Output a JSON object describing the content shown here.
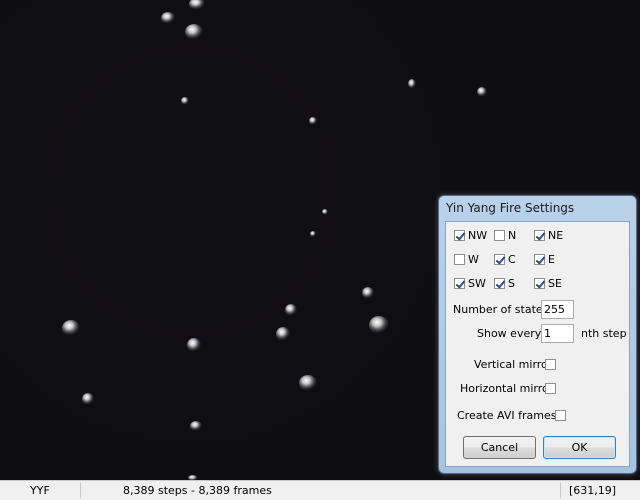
{
  "statusbar": {
    "rule": "YYF",
    "progress": "8,389 steps - 8,389 frames",
    "coords": "[631,19]"
  },
  "dialog": {
    "title": "Yin Yang Fire Settings",
    "neighbors": {
      "nw": {
        "label": "NW",
        "checked": true
      },
      "n": {
        "label": "N",
        "checked": false
      },
      "ne": {
        "label": "NE",
        "checked": true
      },
      "w": {
        "label": "W",
        "checked": false
      },
      "c": {
        "label": "C",
        "checked": true
      },
      "e": {
        "label": "E",
        "checked": true
      },
      "sw": {
        "label": "SW",
        "checked": true
      },
      "s": {
        "label": "S",
        "checked": true
      },
      "se": {
        "label": "SE",
        "checked": true
      }
    },
    "states_label": "Number of states",
    "states_value": "255",
    "show_every_label": "Show every",
    "show_every_value": "1",
    "nth_step_label": "nth step",
    "vertical_mirror_label": "Vertical mirror",
    "vertical_mirror_checked": false,
    "horizontal_mirror_label": "Horizontal mirror",
    "horizontal_mirror_checked": false,
    "avi_label": "Create AVI frames",
    "avi_checked": false,
    "cancel_label": "Cancel",
    "ok_label": "OK"
  }
}
